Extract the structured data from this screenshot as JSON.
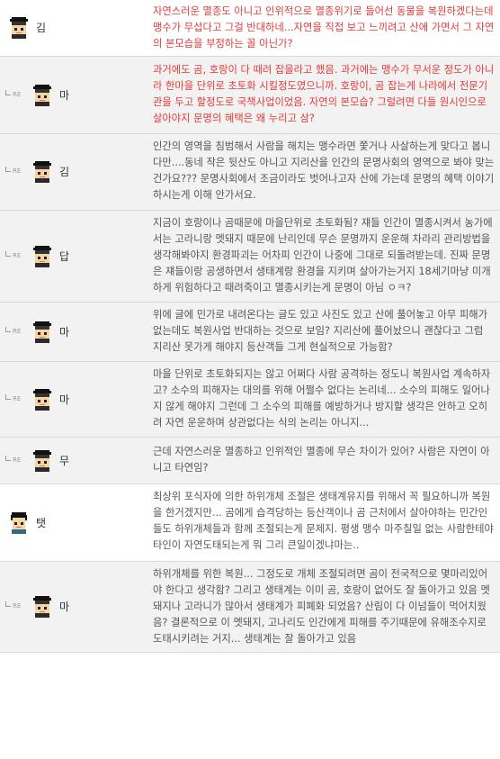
{
  "re_label": "RE",
  "colors": {
    "red_text": "#e23a3a",
    "normal_text": "#555555",
    "reply_bg": "#f2f2f2"
  },
  "comments": [
    {
      "nick": "김",
      "reply": false,
      "red": true,
      "avatar": "hat",
      "text": "자연스러운 멸종도 아니고 인위적으로 멸종위기로 들어선 동물을 복원하겠다는데 맹수가 무섭다고 그걸 반대하네...자연을 직접 보고 느끼려고 산에 가면서 그 자연의 본모습을 부정하는 꼴 아닌가?"
    },
    {
      "nick": "마",
      "reply": true,
      "red": true,
      "avatar": "hat",
      "text": "과거에도 곰, 호랑이 다 때려 잡을라고 했음. 과거에는 맹수가 무서운 정도가 아니라 한마을 단위로 초토화 시킬정도였으니까. 호랑이, 곰 잡는게 나라에서 전문기관을 두고 할정도로 국책사업이었음. 자연의 본모습? 그럴려면 다들 원시인으로 살아야지 문명의 혜택은 왜 누리고 삼?"
    },
    {
      "nick": "김",
      "reply": true,
      "red": false,
      "avatar": "hat",
      "text": "인간의 영역을 침범해서 사람을 해치는 맹수라면 쫓거나 사살하는게 맞다고 봅니다만....동네 작은 뒷산도 아니고 지리산을 인간의 문명사회의 영역으로 봐야 맞는건가요??? 문명사회에서 조금이라도 벗어나고자 산에 가는데 문명의 혜택 이야기 하시는게 이해 안가서요."
    },
    {
      "nick": "답",
      "reply": true,
      "red": false,
      "avatar": "hat",
      "text": "지금이 호랑이나 곰때문에 마을단위로 초토화됨? 쟤들 인간이 멸종시켜서 농가에서는 고라니랑 멧돼지 때문에 난리인데 무슨 문명까지 운운해 차라리 관리방법을 생각해봐야지 환경파괴는 어차피 인간이 나중에 그대로 되돌려받는데. 진짜 문명은 쟤들이랑 공생하면서 생태계랑 환경을 지키며 살아가는거지 18세기마냥 미개하게 위험하다고 때려죽이고 멸종시키는게 문명이 아님 ㅇㅋ?"
    },
    {
      "nick": "마",
      "reply": true,
      "red": false,
      "avatar": "hat",
      "text": "위에 글에 민가로 내려온다는 글도 있고 사진도 있고 산에 풀어놓고 아무 피해가 없는데도 복원사업 반대하는 것으로 보임? 지리산에 풀어놨으니 괜찮다고 그럼 지리산 못가게 해야지 등산객들 그게 현실적으로 가능함?"
    },
    {
      "nick": "마",
      "reply": true,
      "red": false,
      "avatar": "hat",
      "text": "마을 단위로 초토화되지는 않고 어쩌다 사람 공격하는 정도니 복원사업 계속하자고? 소수의 피해자는 대의를 위해 어쩔수 없다는 논리네... 소수의 피해도 일어나지 않게 해야지 그런데 그 소수의 피해를 예방하거나 방지할 생각은 안하고 오히려 자연 운운하며 상관없다는 식의 논리는 아니지..."
    },
    {
      "nick": "무",
      "reply": true,
      "red": false,
      "avatar": "hat",
      "text": "근데 자연스러운 멸종하고 인위적인 멸종에 무슨 차이가 있어? 사람은 자연이 아니고 타연임?"
    },
    {
      "nick": "탯",
      "reply": false,
      "red": false,
      "avatar": "plain",
      "text": "최상위 포식자에 의한 하위개체 조절은 생태계유지를 위해서 꼭 필요하니까 복원을 한거겠지만... 곰에게 습격당하는 등산객이나 곰 근처에서 살아야하는 민간인들도 하위개체들과 함께 조절되는게 문제지. 평생 맹수 마주칠일 없는 사람한테야 타인이 자연도태되는게 뭐 그리 큰일이겠냐마는.."
    },
    {
      "nick": "마",
      "reply": true,
      "red": false,
      "avatar": "hat",
      "text": "하위개체를 위한 복원... 그정도로 개체 조절되려면 곰이 전국적으로 몇마리있어야 한다고 생각함? 그리고 생태계는 이미 곰, 호랑이 없어도 잘 돌아가고 있음 멧돼지나 고라니가 많아서 생태계가 피폐화 되었음? 산림이 다 이넘들이 먹어치웠음? 결론적으로 이 멧돼지, 고나리도 인간에게 피해를 주기때문에 유해조수지로 도태시키려는 거지... 생태계는 잘 돌아가고 있음"
    }
  ]
}
